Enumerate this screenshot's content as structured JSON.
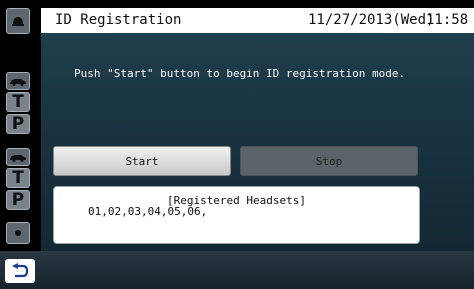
{
  "titlebar": {
    "title": "ID Registration",
    "date": "11/27/2013(Wed)",
    "time": "11:58"
  },
  "main": {
    "message": "Push \"Start\" button to begin ID registration mode.",
    "start_label": "Start",
    "stop_label": "Stop",
    "registered": {
      "title": "[Registered Headsets]",
      "values": "01,02,03,04,05,06,"
    }
  },
  "rail": {
    "items": [
      {
        "icon": "speaker-icon"
      },
      {
        "icon": "car-icon"
      },
      {
        "label": "T"
      },
      {
        "label": "P"
      },
      {
        "icon": "car-icon"
      },
      {
        "label": "T"
      },
      {
        "label": "P"
      },
      {
        "icon": "dot-icon"
      }
    ]
  },
  "bottom": {
    "back_icon": "back-arrow-icon"
  },
  "colors": {
    "panel": "#1f3e4e",
    "stop_button": "#5c6469",
    "start_button": "#e6e6e6"
  }
}
